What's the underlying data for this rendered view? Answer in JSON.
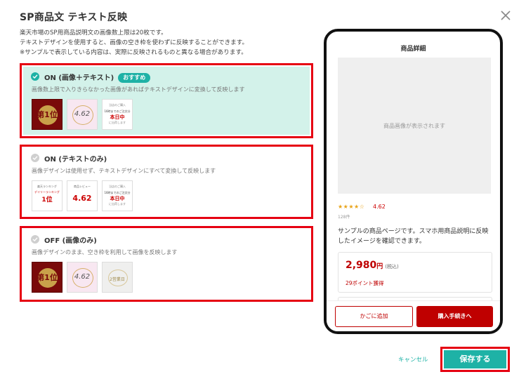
{
  "dialog": {
    "title": "SP商品文 テキスト反映",
    "description": [
      "楽天市場のSP用商品説明文の画像数上限は20枚です。",
      "テキストデザインを使用すると、画像の空き枠を使わずに反映することができます。",
      "※サンプルで表示している内容は、実際に反映されるものと異なる場合があります。"
    ],
    "options": [
      {
        "title": "ON (画像＋テキスト)",
        "badge": "おすすめ",
        "description": "画像数上限で入りきらなかった画像があればテキストデザインに変換して反映します",
        "selected": true
      },
      {
        "title": "ON (テキストのみ)",
        "description": "画像デザインは使用せず、テキストデザインにすべて変換して反映します",
        "selected": false
      },
      {
        "title": "OFF (画像のみ)",
        "description": "画像デザインのまま、空き枠を利用して画像を反映します",
        "selected": false
      }
    ],
    "thumbs": {
      "ranking_num": "第1位",
      "review_num": "4.62",
      "ship_line1": "当店のご購入",
      "ship_line2": "16時までのご注文分",
      "ship_main": "本日中",
      "ship_line4": "に出荷します",
      "txt_ranking_hd": "楽天ランキング",
      "txt_ranking_sub": "デイリーランキング",
      "txt_ranking_big": "1位",
      "txt_review_hd": "商品レビュー",
      "txt_review_big": "4.62",
      "gray_text": "2営業日"
    },
    "cancel_label": "キャンセル",
    "save_label": "保存する"
  },
  "preview": {
    "title": "商品詳細",
    "image_placeholder": "商品画像が表示されます",
    "stars": "★★★★☆",
    "rating": "4.62",
    "reviews": "128件",
    "description": "サンプルの商品ページです。スマホ用商品説明に反映したイメージを確認できます。",
    "price": "2,980",
    "price_unit": "円",
    "price_tax": "(税込)",
    "points": "29ポイント獲得",
    "cart_label": "かごに追加",
    "buy_label": "購入手続きへ"
  },
  "colors": {
    "accent": "#1eb2a6",
    "highlight": "#e60012",
    "price": "#bf0000",
    "selected_bg": "#d3f2ea"
  }
}
